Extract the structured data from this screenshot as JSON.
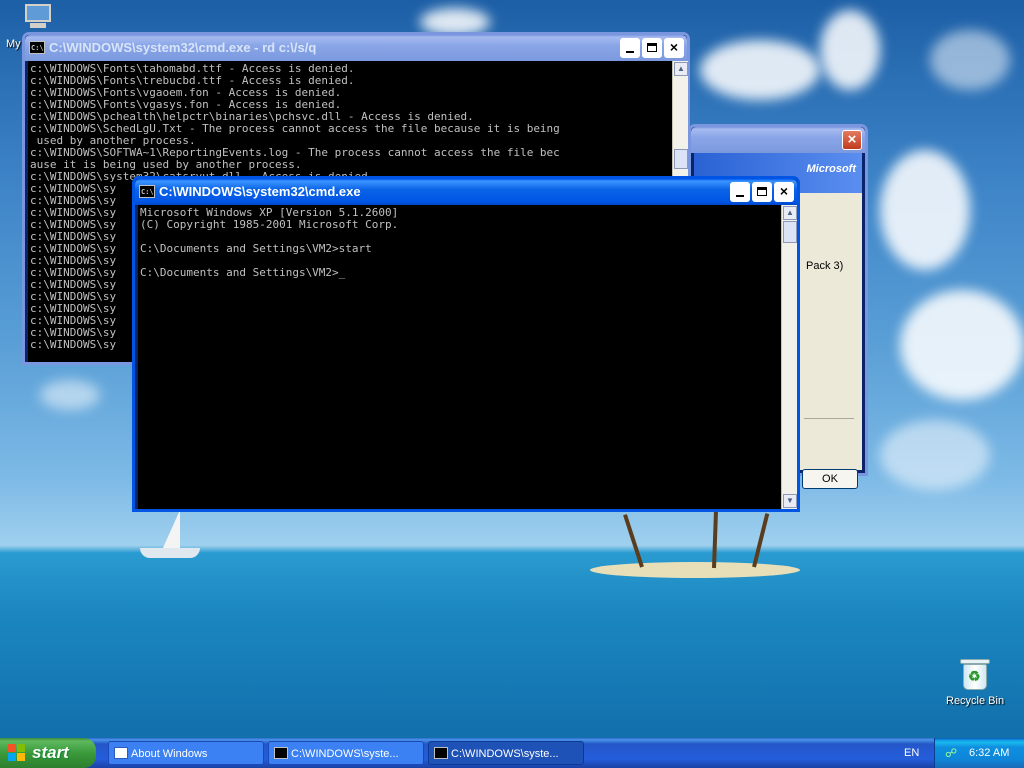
{
  "desktop": {
    "icons": [
      {
        "label": "My"
      },
      {
        "label": "Recycle Bin"
      }
    ]
  },
  "cmd_back": {
    "title": "C:\\WINDOWS\\system32\\cmd.exe - rd c:\\/s/q",
    "lines": [
      "c:\\WINDOWS\\Fonts\\tahomabd.ttf - Access is denied.",
      "c:\\WINDOWS\\Fonts\\trebucbd.ttf - Access is denied.",
      "c:\\WINDOWS\\Fonts\\vgaoem.fon - Access is denied.",
      "c:\\WINDOWS\\Fonts\\vgasys.fon - Access is denied.",
      "c:\\WINDOWS\\pchealth\\helpctr\\binaries\\pchsvc.dll - Access is denied.",
      "c:\\WINDOWS\\SchedLgU.Txt - The process cannot access the file because it is being",
      " used by another process.",
      "c:\\WINDOWS\\SOFTWA~1\\ReportingEvents.log - The process cannot access the file bec",
      "ause it is being used by another process.",
      "c:\\WINDOWS\\system32\\catsrvut.dll - Access is denied.",
      "c:\\WINDOWS\\sy",
      "c:\\WINDOWS\\sy",
      "c:\\WINDOWS\\sy",
      "c:\\WINDOWS\\sy",
      "c:\\WINDOWS\\sy",
      "c:\\WINDOWS\\sy",
      "c:\\WINDOWS\\sy",
      "c:\\WINDOWS\\sy",
      "c:\\WINDOWS\\sy",
      "c:\\WINDOWS\\sy",
      "c:\\WINDOWS\\sy",
      "c:\\WINDOWS\\sy",
      "c:\\WINDOWS\\sy",
      "c:\\WINDOWS\\sy"
    ]
  },
  "cmd_front": {
    "title": "C:\\WINDOWS\\system32\\cmd.exe",
    "lines": [
      "Microsoft Windows XP [Version 5.1.2600]",
      "(C) Copyright 1985-2001 Microsoft Corp.",
      "",
      "C:\\Documents and Settings\\VM2>start",
      "",
      "C:\\Documents and Settings\\VM2>_"
    ]
  },
  "about": {
    "brand": "Microsoft",
    "text_fragment": "Pack 3)",
    "ok_label": "OK"
  },
  "window_buttons": {
    "minimize": "_",
    "maximize": "□",
    "close": "×"
  },
  "taskbar": {
    "start_label": "start",
    "tasks": [
      {
        "label": "About Windows"
      },
      {
        "label": "C:\\WINDOWS\\syste..."
      },
      {
        "label": "C:\\WINDOWS\\syste..."
      }
    ],
    "language": "EN",
    "clock": "6:32 AM"
  },
  "colors": {
    "xp_title_blue": "#0055e5",
    "console_bg": "#000000",
    "console_text": "#c0c0c0",
    "start_green": "#3a9a3a"
  }
}
